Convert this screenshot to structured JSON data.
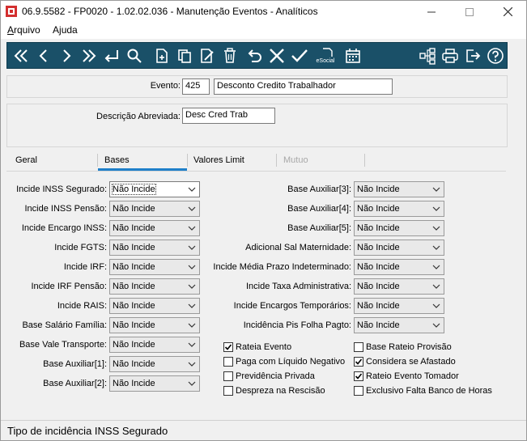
{
  "window": {
    "title": "06.9.5582 - FP0020 - 1.02.02.036 - Manutenção Eventos - Analíticos",
    "controls": {
      "minimize": "—",
      "maximize": "☐",
      "close": "✕"
    }
  },
  "menu": {
    "items": [
      {
        "label": "Arquivo",
        "mnemonic": "A"
      },
      {
        "label": "Ajuda",
        "mnemonic": "j"
      }
    ]
  },
  "toolbar": {
    "color": "#1a5068",
    "social_label": "eSocial",
    "left_icons": [
      "first-icon",
      "previous-icon",
      "next-icon",
      "last-icon",
      "enter-icon",
      "search-icon",
      "new-icon",
      "copy-icon",
      "edit-icon",
      "delete-icon",
      "undo-icon",
      "cancel-icon",
      "confirm-icon",
      "esocial-icon",
      "calendar-icon"
    ],
    "right_icons": [
      "tree-icon",
      "print-icon",
      "exit-icon",
      "help-icon"
    ]
  },
  "header": {
    "evento_label": "Evento:",
    "evento_code": "425",
    "evento_name": "Desconto Credito Trabalhador",
    "descricao_label": "Descrição Abreviada:",
    "descricao_value": "Desc Cred Trab"
  },
  "tabs": [
    {
      "label": "Geral",
      "active": false,
      "enabled": true
    },
    {
      "label": "Bases",
      "active": true,
      "enabled": true
    },
    {
      "label": "Valores Limit",
      "active": false,
      "enabled": true
    },
    {
      "label": "Mutuo",
      "active": false,
      "enabled": false
    }
  ],
  "bases": {
    "left_fields": [
      {
        "label": "Incide INSS Segurado:",
        "value": "Não Incide",
        "focused": true
      },
      {
        "label": "Incide INSS Pensão:",
        "value": "Não Incide"
      },
      {
        "label": "Incide Encargo INSS:",
        "value": "Não Incide"
      },
      {
        "label": "Incide FGTS:",
        "value": "Não Incide"
      },
      {
        "label": "Incide IRF:",
        "value": "Não Incide"
      },
      {
        "label": "Incide IRF Pensão:",
        "value": "Não Incide"
      },
      {
        "label": "Incide RAIS:",
        "value": "Não Incide"
      },
      {
        "label": "Base Salário Família:",
        "value": "Não Incide"
      },
      {
        "label": "Base Vale Transporte:",
        "value": "Não Incide"
      },
      {
        "label": "Base Auxiliar[1]:",
        "value": "Não Incide"
      },
      {
        "label": "Base Auxiliar[2]:",
        "value": "Não Incide"
      }
    ],
    "right_fields": [
      {
        "label": "Base Auxiliar[3]:",
        "value": "Não Incide"
      },
      {
        "label": "Base Auxiliar[4]:",
        "value": "Não Incide"
      },
      {
        "label": "Base Auxiliar[5]:",
        "value": "Não Incide"
      },
      {
        "label": "Adicional Sal Maternidade:",
        "value": "Não Incide"
      },
      {
        "label": "Incide Média Prazo Indeterminado:",
        "value": "Não Incide"
      },
      {
        "label": "Incide Taxa Administrativa:",
        "value": "Não Incide"
      },
      {
        "label": "Incide Encargos Temporários:",
        "value": "Não Incide"
      },
      {
        "label": "Incidência Pis Folha Pagto:",
        "value": "Não Incide"
      }
    ],
    "checkboxes_col1": [
      {
        "label": "Rateia Evento",
        "checked": true
      },
      {
        "label": "Paga com Líquido Negativo",
        "checked": false
      },
      {
        "label": "Previdência Privada",
        "checked": false
      },
      {
        "label": "Despreza na Rescisão",
        "checked": false
      }
    ],
    "checkboxes_col2": [
      {
        "label": "Base Rateio Provisão",
        "checked": false
      },
      {
        "label": "Considera se Afastado",
        "checked": true
      },
      {
        "label": "Rateio Evento Tomador",
        "checked": true
      },
      {
        "label": "Exclusivo Falta Banco de Horas",
        "checked": false
      }
    ]
  },
  "status": {
    "text": "Tipo de incidência INSS Segurado"
  }
}
